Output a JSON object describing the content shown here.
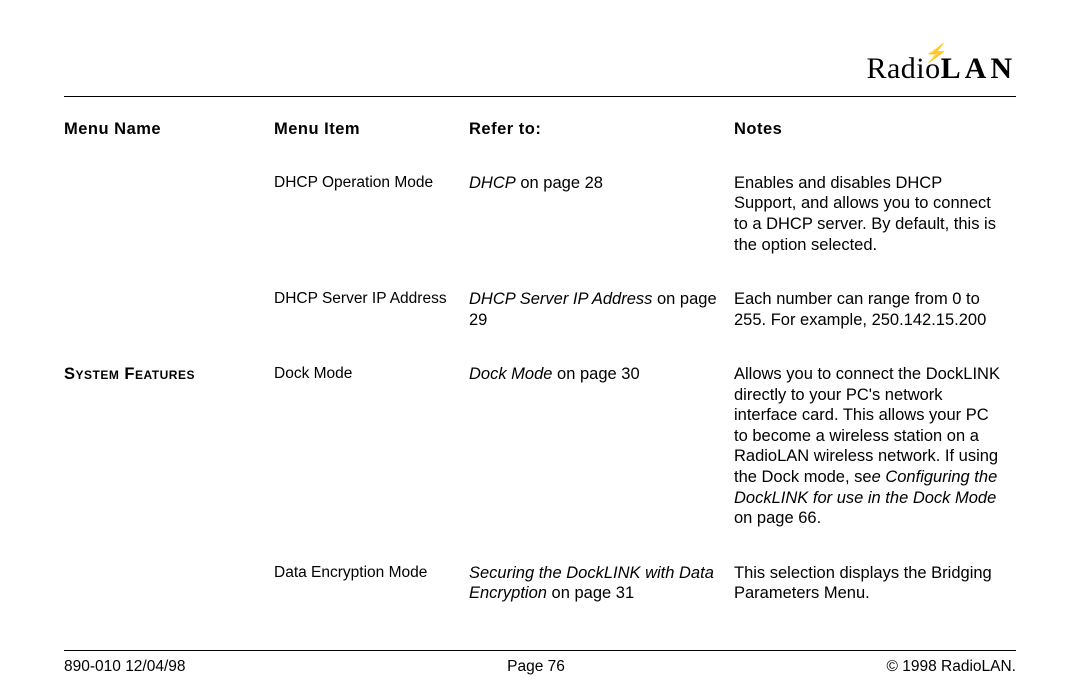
{
  "logo": {
    "part1": "Radio",
    "part2": "LAN"
  },
  "headers": {
    "menu_name": "Menu Name",
    "menu_item": "Menu Item",
    "refer_to": "Refer to:",
    "notes": "Notes"
  },
  "rows": [
    {
      "menu_name": "",
      "menu_item": "DHCP Operation Mode",
      "refer_ital": "DHCP",
      "refer_plain": " on page 28",
      "notes": "Enables and disables DHCP Support, and allows you to connect to a DHCP server. By default, this is the option selected."
    },
    {
      "menu_name": "",
      "menu_item": "DHCP Server IP Address",
      "refer_ital": "DHCP Server IP Address",
      "refer_plain": " on page 29",
      "notes": "Each number can range from 0 to 255. For example, 250.142.15.200"
    },
    {
      "menu_name": "System Features",
      "menu_item": "Dock Mode",
      "refer_ital": "Dock Mode",
      "refer_plain": " on page 30",
      "notes_pre": "Allows you to connect the DockLINK directly to your PC's network interface card. This allows your PC to become a wireless station on a RadioLAN wireless network. If using the Dock mode, se",
      "notes_ital": "e Configuring the DockLINK for use in the Dock Mode",
      "notes_post": " on page 66."
    },
    {
      "menu_name": "",
      "menu_item": "Data Encryption Mode",
      "refer_ital": "Securing the DockLINK with Data Encryption",
      "refer_plain": " on page 31",
      "notes": "This selection displays the Bridging Parameters Menu."
    }
  ],
  "footer": {
    "left": "890-010  12/04/98",
    "center": "Page 76",
    "right": "© 1998 RadioLAN."
  }
}
